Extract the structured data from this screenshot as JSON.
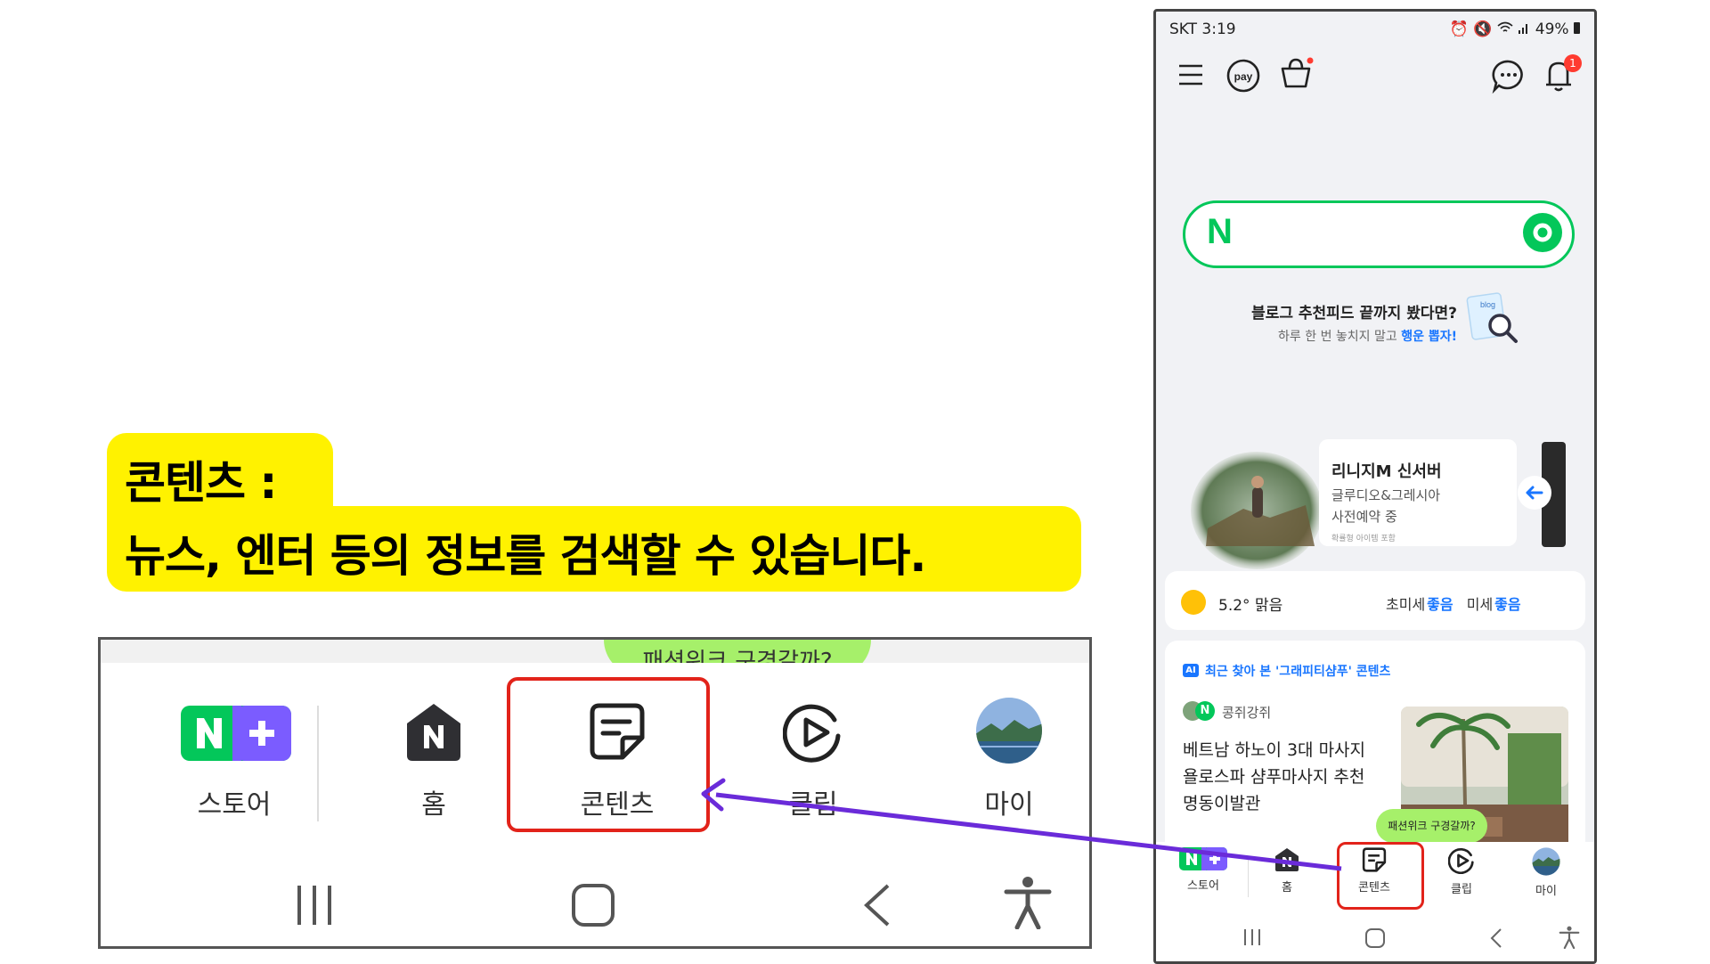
{
  "callout": {
    "line1": "콘텐츠 :",
    "line2": "뉴스, 엔터 등의 정보를 검색할  수 있습니다."
  },
  "zoom_nav": {
    "bubble_text": "패션위크 구경갈까?",
    "items": [
      {
        "label": "스토어",
        "icon": "naver-plus-store-icon"
      },
      {
        "label": "홈",
        "icon": "naver-home-icon"
      },
      {
        "label": "콘텐츠",
        "icon": "contents-icon"
      },
      {
        "label": "클립",
        "icon": "clip-play-icon"
      },
      {
        "label": "마이",
        "icon": "profile-avatar-icon"
      }
    ]
  },
  "phone": {
    "status": {
      "carrier_time": "SKT 3:19",
      "battery": "49%"
    },
    "notification_count": "1",
    "search_logo": "N",
    "promo": {
      "title": "블로그 추천피드 끝까지 봤다면?",
      "sub_prefix": "하루 한 번 놓치지 말고 ",
      "sub_highlight": "행운 뽑자!",
      "badge": "blog"
    },
    "ad": {
      "title": "리니지M 신서버",
      "line1": "글루디오&그레시아",
      "line2": "사전예약 중",
      "note": "확률형 아이템 포함"
    },
    "weather": {
      "temp": "5.2° 맑음",
      "fine_dust_label": "초미세",
      "fine_dust_value": "좋음",
      "dust_label": "미세",
      "dust_value": "좋음"
    },
    "feed": {
      "ai_badge": "AI",
      "heading": "최근 찾아 본 '그래피티샴푸' 콘텐츠",
      "author": "콩쥐강쥐",
      "title_lines": [
        "베트남 하노이 3대 마사지",
        "욜로스파 샴푸마사지 추천",
        "명동이발관"
      ]
    },
    "bubble_text": "패션위크 구경갈까?",
    "nav": [
      {
        "label": "스토어"
      },
      {
        "label": "홈"
      },
      {
        "label": "콘텐츠"
      },
      {
        "label": "클립"
      },
      {
        "label": "마이"
      }
    ]
  },
  "colors": {
    "callout": "#fff200",
    "naver_green": "#03c75a",
    "highlight_red": "#e2231a",
    "arrow": "#6a2bd9",
    "link_blue": "#1976ff"
  }
}
